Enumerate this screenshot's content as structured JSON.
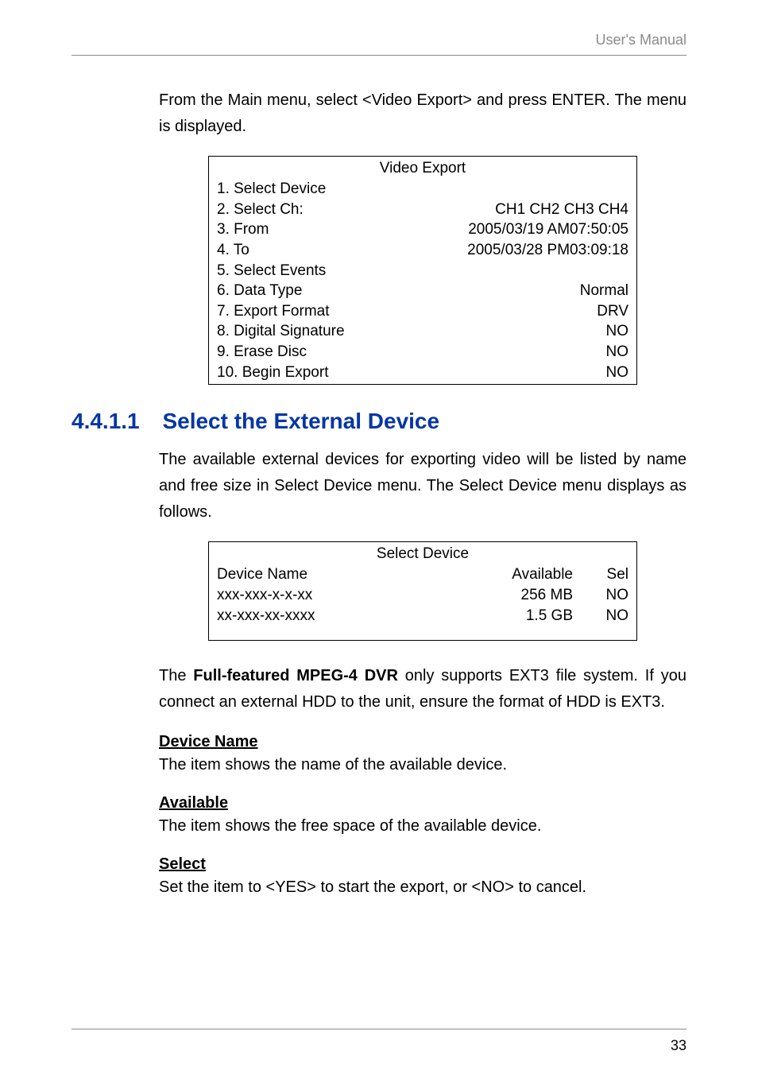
{
  "header": {
    "title": "User's Manual"
  },
  "intro_para": "From the Main menu, select <Video Export> and press ENTER. The menu is displayed.",
  "video_export": {
    "title": "Video Export",
    "rows": [
      {
        "label": "1. Select Device",
        "value": ""
      },
      {
        "label": "2. Select Ch:",
        "value": "CH1 CH2 CH3 CH4"
      },
      {
        "label": "3. From",
        "value": "2005/03/19 AM07:50:05"
      },
      {
        "label": "4. To",
        "value": "2005/03/28 PM03:09:18"
      },
      {
        "label": "5. Select Events",
        "value": ""
      },
      {
        "label": "6. Data Type",
        "value": "Normal"
      },
      {
        "label": "7. Export Format",
        "value": "DRV"
      },
      {
        "label": "8. Digital Signature",
        "value": "NO"
      },
      {
        "label": "9. Erase Disc",
        "value": "NO"
      },
      {
        "label": "10. Begin Export",
        "value": "NO"
      }
    ]
  },
  "section": {
    "number": "4.4.1.1",
    "title": "Select the External Device",
    "para": "The available external devices for exporting video will be listed by name and free size in Select Device menu. The Select Device menu displays as follows."
  },
  "select_device": {
    "title": "Select Device",
    "header": {
      "name": "Device Name",
      "available": "Available",
      "sel": "Sel"
    },
    "rows": [
      {
        "name": "xxx-xxx-x-x-xx",
        "available": "256 MB",
        "sel": "NO"
      },
      {
        "name": "xx-xxx-xx-xxxx",
        "available": "1.5 GB",
        "sel": "NO"
      }
    ]
  },
  "ext3_para_pre": "The ",
  "ext3_bold": "Full-featured MPEG-4 DVR",
  "ext3_para_post": " only supports EXT3 file system. If you connect an external HDD to the unit, ensure the format of HDD is EXT3.",
  "subsections": {
    "device_name": {
      "heading": "Device Name",
      "text": "The item shows the name of the available device."
    },
    "available": {
      "heading": "Available",
      "text": "The item shows the free space of the available device."
    },
    "select": {
      "heading": "Select",
      "text": "Set the item to <YES> to start the export, or <NO> to cancel."
    }
  },
  "footer": {
    "page_number": "33"
  }
}
